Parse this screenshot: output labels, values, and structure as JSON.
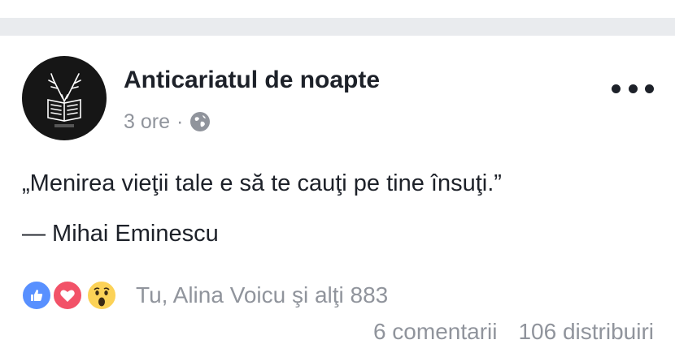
{
  "post": {
    "page_name": "Anticariatul de noapte",
    "time": "3 ore",
    "separator": "·",
    "privacy_icon": "globe-icon",
    "more_icon": "more-options-icon",
    "quote": "„Menirea vieţii tale e să te cauţi pe tine însuţi.”",
    "author": "— Mihai Eminescu"
  },
  "reactions": {
    "icons": [
      "like-icon",
      "love-icon",
      "wow-icon"
    ],
    "text": "Tu, Alina Voicu şi alţi 883"
  },
  "stats": {
    "comments": "6 comentarii",
    "shares": "106 distribuiri"
  },
  "colors": {
    "divider": "#e9ebee",
    "text": "#1d2129",
    "secondary": "#90949c",
    "like": "#5890ff",
    "love": "#f25268",
    "wow": "#fcd257"
  }
}
